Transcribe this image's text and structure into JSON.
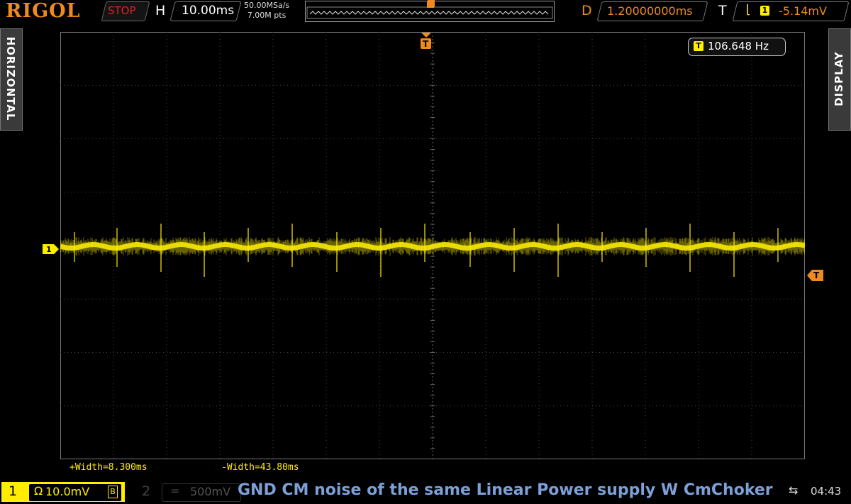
{
  "brand": "RIGOL",
  "status": {
    "run_state": "STOP"
  },
  "horizontal": {
    "key": "H",
    "timebase": "10.00ms",
    "sample_rate": "50.00MSa/s",
    "memory_depth": "7.00M pts"
  },
  "delay": {
    "key": "D",
    "value": "1.20000000ms"
  },
  "trigger": {
    "key": "T",
    "source": "1",
    "level": "-5.14mV"
  },
  "side_tabs": {
    "left": "HORIZONTAL",
    "right": "DISPLAY"
  },
  "markers": {
    "trigger_pos": "T",
    "channel1": "1",
    "trigger_level": "T"
  },
  "measurements": {
    "frequency": "106.648 Hz",
    "frequency_icon": "T",
    "pos_width": "+Width=8.300ms",
    "neg_width": "-Width=43.80ms"
  },
  "channels": [
    {
      "num": "1",
      "coupling_icon": "Ω",
      "scale": "10.0mV",
      "bw_icon": "B",
      "color": "#ffee00"
    },
    {
      "num": "2",
      "coupling_icon": "=",
      "scale": "500mV",
      "color": "#444444"
    }
  ],
  "caption": "GND CM noise of the same Linear Power supply W CmChoker",
  "system": {
    "usb_icon": "usb-icon",
    "time": "04:43"
  },
  "colors": {
    "trace": "#ffee00",
    "brand": "#f08a1c",
    "grid": "#3a3a3a",
    "caption": "#7ea0d8"
  }
}
